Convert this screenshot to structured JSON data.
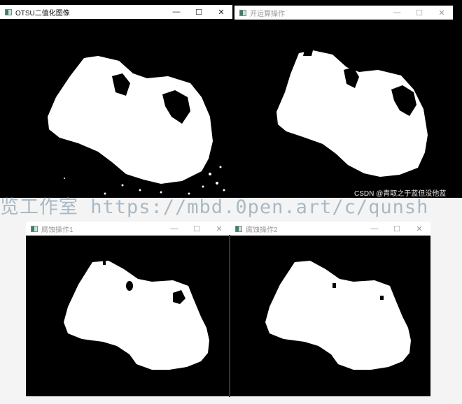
{
  "windows": [
    {
      "id": "otsu",
      "title": "OTSU二值化图像",
      "min": "—",
      "max": "☐",
      "close": "✕",
      "faded": false
    },
    {
      "id": "open",
      "title": "开运算操作",
      "min": "—",
      "max": "☐",
      "close": "✕",
      "faded": true
    },
    {
      "id": "erode1",
      "title": "腐蚀操作1",
      "min": "—",
      "max": "☐",
      "close": "✕",
      "faded": true
    },
    {
      "id": "erode2",
      "title": "腐蚀操作2",
      "min": "—",
      "max": "☐",
      "close": "✕",
      "faded": true
    }
  ],
  "watermark": "览工作室 https://mbd.0pen.art/c/qunsh",
  "credit": "CSDN @青取之于蓝但没他蓝",
  "icons": {
    "app": "opencv-window-icon",
    "minimize": "minimize-icon",
    "maximize": "maximize-icon",
    "close": "close-icon"
  }
}
